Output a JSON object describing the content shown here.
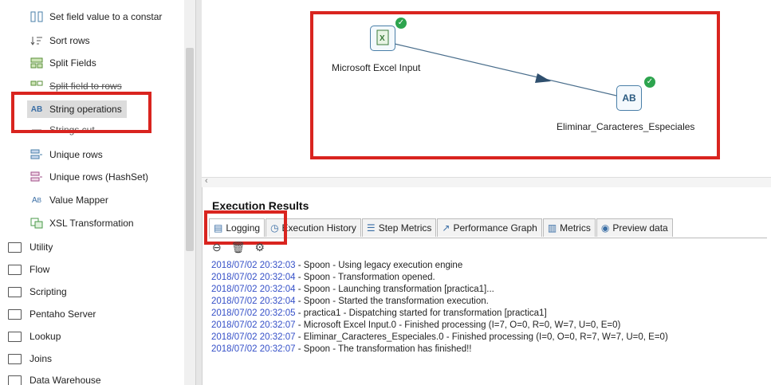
{
  "steps": [
    {
      "label": "Set field value to a constar",
      "icon": "set-field-icon"
    },
    {
      "label": "Sort rows",
      "icon": "sort-icon"
    },
    {
      "label": "Split Fields",
      "icon": "split-icon"
    },
    {
      "label": "Split field to rows",
      "icon": "split-rows-icon"
    },
    {
      "label": "String operations",
      "icon": "string-ops-icon"
    },
    {
      "label": "Strings cut",
      "icon": "strings-cut-icon"
    },
    {
      "label": "Unique rows",
      "icon": "unique-icon"
    },
    {
      "label": "Unique rows (HashSet)",
      "icon": "unique-hash-icon"
    },
    {
      "label": "Value Mapper",
      "icon": "value-mapper-icon"
    },
    {
      "label": "XSL Transformation",
      "icon": "xsl-icon"
    }
  ],
  "folders": [
    "Utility",
    "Flow",
    "Scripting",
    "Pentaho Server",
    "Lookup",
    "Joins",
    "Data Warehouse"
  ],
  "canvas": {
    "node1_label": "Microsoft Excel Input",
    "node2_label": "Eliminar_Caracteres_Especiales",
    "node2_glyph": "AB"
  },
  "execution": {
    "title": "Execution Results",
    "tabs": [
      "Logging",
      "Execution History",
      "Step Metrics",
      "Performance Graph",
      "Metrics",
      "Preview data"
    ]
  },
  "log": [
    {
      "ts": "2018/07/02 20:32:03",
      "msg": " - Spoon - Using legacy execution engine"
    },
    {
      "ts": "2018/07/02 20:32:04",
      "msg": " - Spoon - Transformation opened."
    },
    {
      "ts": "2018/07/02 20:32:04",
      "msg": " - Spoon - Launching transformation [practica1]..."
    },
    {
      "ts": "2018/07/02 20:32:04",
      "msg": " - Spoon - Started the transformation execution."
    },
    {
      "ts": "2018/07/02 20:32:05",
      "msg": " - practica1 - Dispatching started for transformation [practica1]"
    },
    {
      "ts": "2018/07/02 20:32:07",
      "msg": " - Microsoft Excel Input.0 - Finished processing (I=7, O=0, R=0, W=7, U=0, E=0)"
    },
    {
      "ts": "2018/07/02 20:32:07",
      "msg": " - Eliminar_Caracteres_Especiales.0 - Finished processing (I=0, O=0, R=7, W=7, U=0, E=0)"
    },
    {
      "ts": "2018/07/02 20:32:07",
      "msg": " - Spoon - The transformation has finished!!"
    }
  ]
}
